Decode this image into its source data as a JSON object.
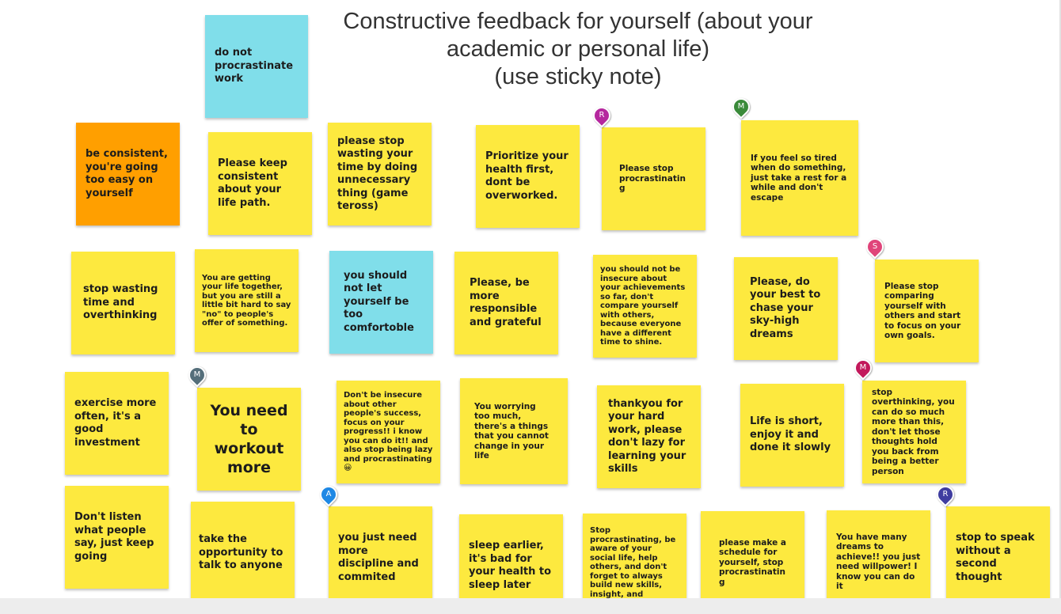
{
  "board": {
    "title_lines": [
      "Constructive feedback for yourself (about your",
      "academic or personal life)",
      "(use sticky note)"
    ]
  },
  "notes": [
    {
      "text": "do not procrastinate work",
      "color": "#80deea"
    },
    {
      "text": "be consistent, you're going too easy on yourself",
      "color": "#ff9f00"
    },
    {
      "text": "Please keep consistent about your life path.",
      "color": "#fde93f"
    },
    {
      "text": "please stop wasting your time by doing unnecessary thing (game teross)",
      "color": "#fde93f"
    },
    {
      "text": "Prioritize your health first, dont be overworked.",
      "color": "#fde93f"
    },
    {
      "text": "Please stop procrastinating",
      "color": "#fde93f"
    },
    {
      "text": "If you feel so tired when do something, just take a rest for a while and don't escape",
      "color": "#fde93f"
    },
    {
      "text": "stop wasting time and overthinking",
      "color": "#fde93f"
    },
    {
      "text": "You are getting your life together, but you are still a little bit hard to say \"no\" to people's offer of something.",
      "color": "#fde93f"
    },
    {
      "text": "you should not let yourself be too comfortoble",
      "color": "#80deea"
    },
    {
      "text": "Please, be more responsible and grateful",
      "color": "#fde93f"
    },
    {
      "text": "you should not be insecure about your achievements so far, don't compare yourself with others, because everyone have a different time to shine.",
      "color": "#fde93f"
    },
    {
      "text": "Please, do your best to chase your sky-high dreams",
      "color": "#fde93f"
    },
    {
      "text": "Please stop comparing yourself with others and start to focus on your own goals.",
      "color": "#fde93f"
    },
    {
      "text": "exercise more often, it's a good investment",
      "color": "#fde93f"
    },
    {
      "text": "You need to workout more",
      "color": "#fde93f"
    },
    {
      "text": "Don't be insecure about other people's success, focus on your progress!! i know you can do it!! and also stop being lazy and procrastinating 😀",
      "color": "#fde93f"
    },
    {
      "text": "You worrying too much, there's a things that you cannot change in your life",
      "color": "#fde93f"
    },
    {
      "text": "thankyou for your hard work, please don't lazy for learning your skills",
      "color": "#fde93f"
    },
    {
      "text": "Life is short, enjoy it and done it slowly",
      "color": "#fde93f"
    },
    {
      "text": "stop overthinking, you can do so much more than this, don't let those thoughts hold you back from being a better person",
      "color": "#fde93f"
    },
    {
      "text": "Don't listen what people say, just keep going",
      "color": "#fde93f"
    },
    {
      "text": "take the opportunity to talk to anyone",
      "color": "#fde93f"
    },
    {
      "text": "you just need more discipline and commited",
      "color": "#fde93f"
    },
    {
      "text": "sleep earlier, it's bad for your health to sleep later",
      "color": "#fde93f"
    },
    {
      "text": "Stop procrastinating, be aware of your social life, help others, and don't forget to always build new skills, insight, and muscles:D",
      "color": "#fde93f"
    },
    {
      "text": "please make a schedule for yourself, stop procrastinating",
      "color": "#fde93f"
    },
    {
      "text": "You have many dreams to achieve!! you just need willpower! I know you can do it",
      "color": "#fde93f"
    },
    {
      "text": "stop to speak without a second thought",
      "color": "#fde93f"
    }
  ],
  "author_pins": [
    {
      "initial": "R",
      "color": "#b5279e"
    },
    {
      "initial": "M",
      "color": "#3a8a3a"
    },
    {
      "initial": "S",
      "color": "#e0447a"
    },
    {
      "initial": "M",
      "color": "#546e7a"
    },
    {
      "initial": "M",
      "color": "#c2185b"
    },
    {
      "initial": "A",
      "color": "#1e88e5"
    },
    {
      "initial": "R",
      "color": "#3f3da0"
    }
  ]
}
